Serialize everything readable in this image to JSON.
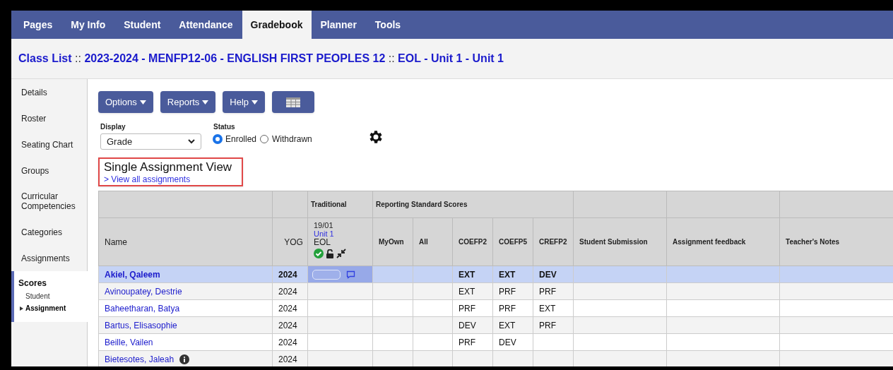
{
  "nav_tabs": [
    {
      "label": "Pages",
      "selected": false
    },
    {
      "label": "My Info",
      "selected": false
    },
    {
      "label": "Student",
      "selected": false
    },
    {
      "label": "Attendance",
      "selected": false
    },
    {
      "label": "Gradebook",
      "selected": true
    },
    {
      "label": "Planner",
      "selected": false
    },
    {
      "label": "Tools",
      "selected": false
    }
  ],
  "breadcrumb": [
    "Class List",
    "2023-2024 - MENFP12-06 - ENGLISH FIRST PEOPLES 12",
    "EOL - Unit 1 - Unit 1"
  ],
  "breadcrumb_separator": "::",
  "sidebar": {
    "items": [
      {
        "label": "Details",
        "selected": false
      },
      {
        "label": "Roster",
        "selected": false
      },
      {
        "label": "Seating Chart",
        "selected": false
      },
      {
        "label": "Groups",
        "selected": false
      },
      {
        "label": "Curricular Competencies",
        "selected": false
      },
      {
        "label": "Categories",
        "selected": false
      },
      {
        "label": "Assignments",
        "selected": false
      },
      {
        "label": "Scores",
        "selected": true,
        "children": [
          {
            "label": "Student",
            "selected": false
          },
          {
            "label": "Assignment",
            "selected": true
          }
        ]
      }
    ]
  },
  "toolbar": {
    "buttons": [
      {
        "label": "Options",
        "kind": "menu"
      },
      {
        "label": "Reports",
        "kind": "menu"
      },
      {
        "label": "Help",
        "kind": "menu"
      },
      {
        "kind": "grid"
      }
    ]
  },
  "display": {
    "label": "Display",
    "value": "Grade"
  },
  "status": {
    "label": "Status",
    "options": [
      {
        "label": "Enrolled",
        "selected": true
      },
      {
        "label": "Withdrawn",
        "selected": false
      }
    ]
  },
  "view": {
    "title": "Single Assignment View",
    "link": "> View all assignments"
  },
  "table": {
    "group_headers": [
      "Traditional",
      "Reporting Standard Scores"
    ],
    "assignment": {
      "date": "19/01",
      "name": "Unit 1",
      "category": "EOL"
    },
    "columns": [
      "Name",
      "YOG",
      "MyOwn",
      "All",
      "COEFP2",
      "COEFP5",
      "CREFP2",
      "Student Submission",
      "Assignment feedback",
      "Teacher's Notes"
    ],
    "rows": [
      {
        "name": "Akiel, Qaleem",
        "yog": "2024",
        "coefp2": "EXT",
        "coefp5": "EXT",
        "crefp2": "DEV",
        "selected": true,
        "info": false
      },
      {
        "name": "Avinoupatey, Destrie",
        "yog": "2024",
        "coefp2": "EXT",
        "coefp5": "PRF",
        "crefp2": "PRF",
        "selected": false,
        "info": false
      },
      {
        "name": "Baheetharan, Batya",
        "yog": "2024",
        "coefp2": "PRF",
        "coefp5": "PRF",
        "crefp2": "EXT",
        "selected": false,
        "info": false
      },
      {
        "name": "Bartus, Elisasophie",
        "yog": "2024",
        "coefp2": "DEV",
        "coefp5": "EXT",
        "crefp2": "PRF",
        "selected": false,
        "info": false
      },
      {
        "name": "Beille, Vailen",
        "yog": "2024",
        "coefp2": "PRF",
        "coefp5": "DEV",
        "selected": false,
        "info": false
      },
      {
        "name": "Bietesotes, Jaleah",
        "yog": "2024",
        "selected": false,
        "info": true
      }
    ]
  }
}
